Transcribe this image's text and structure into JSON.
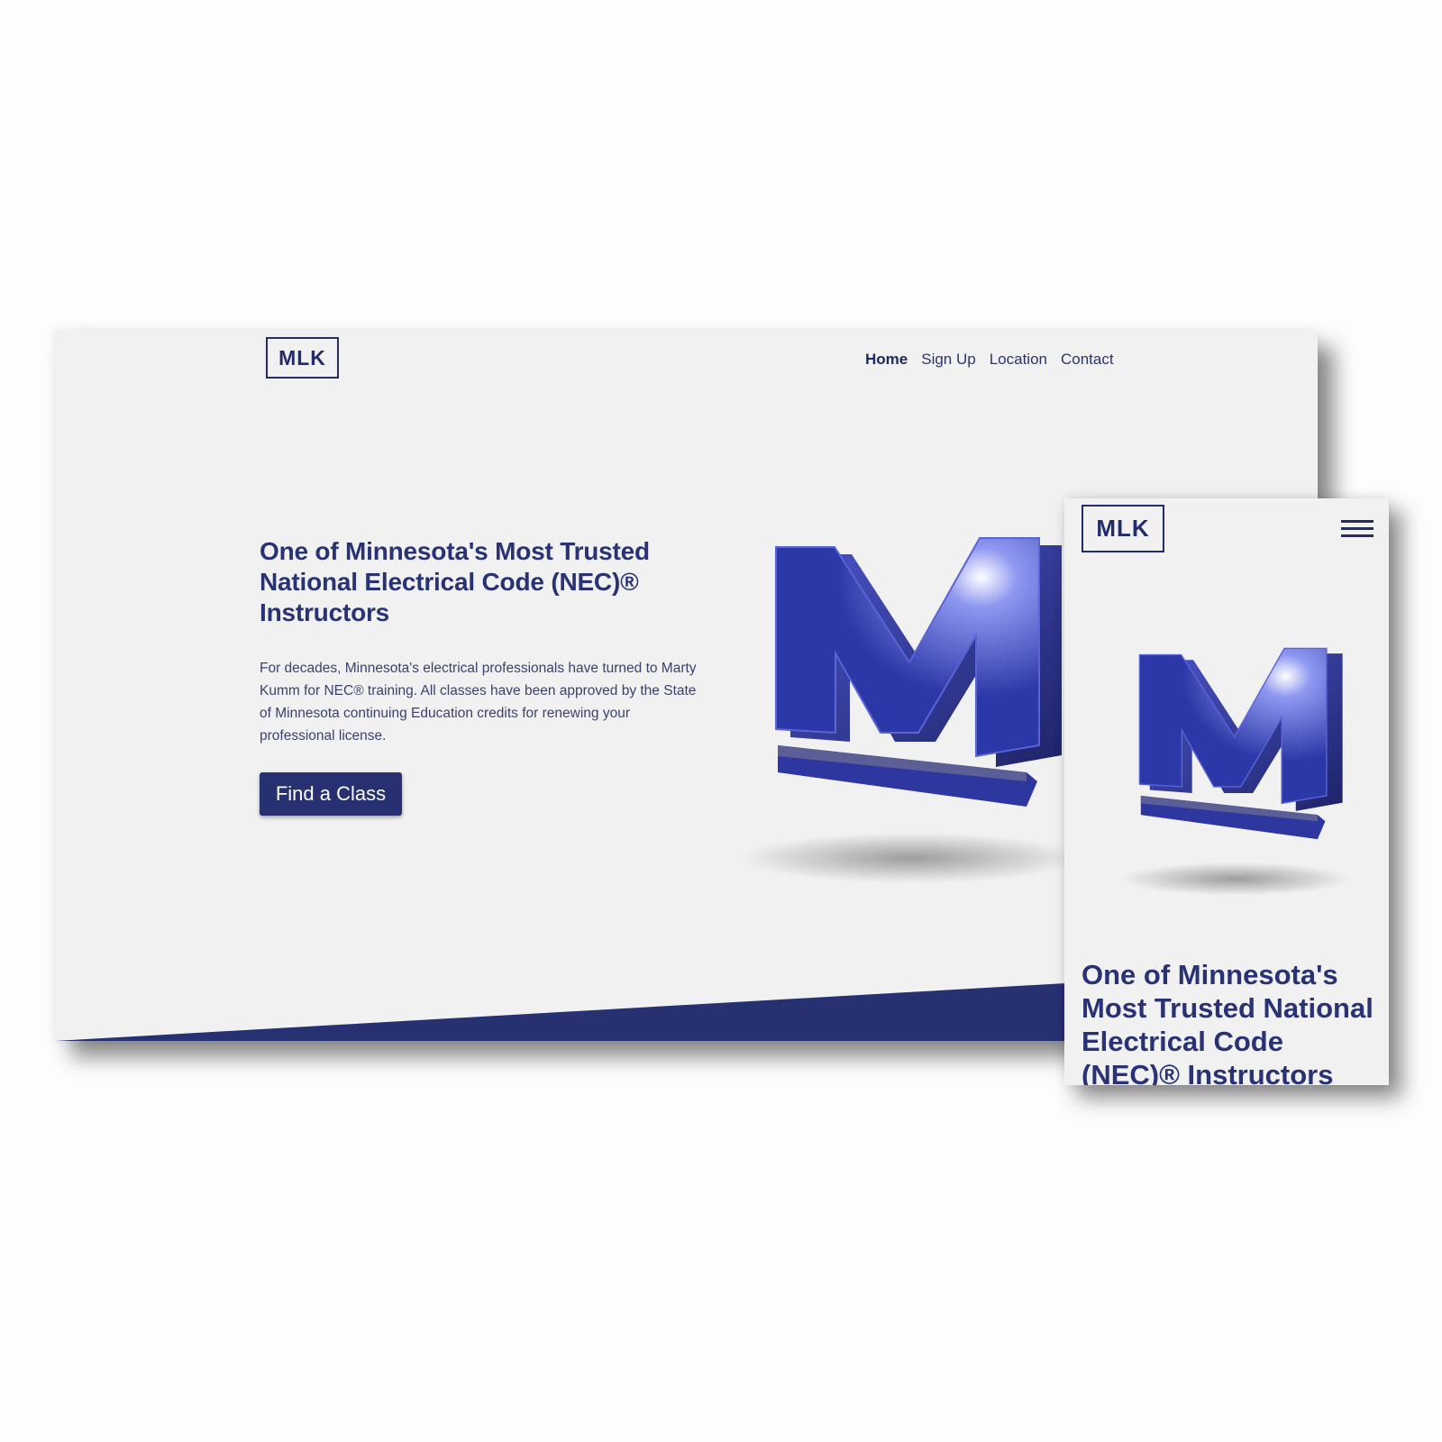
{
  "brand": {
    "logo_text": "MLK",
    "primary_color": "#273070",
    "background_color": "#f1f1f1"
  },
  "nav": {
    "items": [
      {
        "label": "Home",
        "active": true
      },
      {
        "label": "Sign Up",
        "active": false
      },
      {
        "label": "Location",
        "active": false
      },
      {
        "label": "Contact",
        "active": false
      }
    ]
  },
  "hero": {
    "headline": "One of Minnesota's Most Trusted National Electrical Code (NEC)® Instructors",
    "body": "For decades, Minnesota's electrical professionals have turned to Marty Kumm for NEC® training. All classes have been approved by the State of Minnesota continuing Education credits for renewing your professional license.",
    "cta_label": "Find a Class"
  },
  "mobile": {
    "menu_icon": "hamburger-icon"
  }
}
